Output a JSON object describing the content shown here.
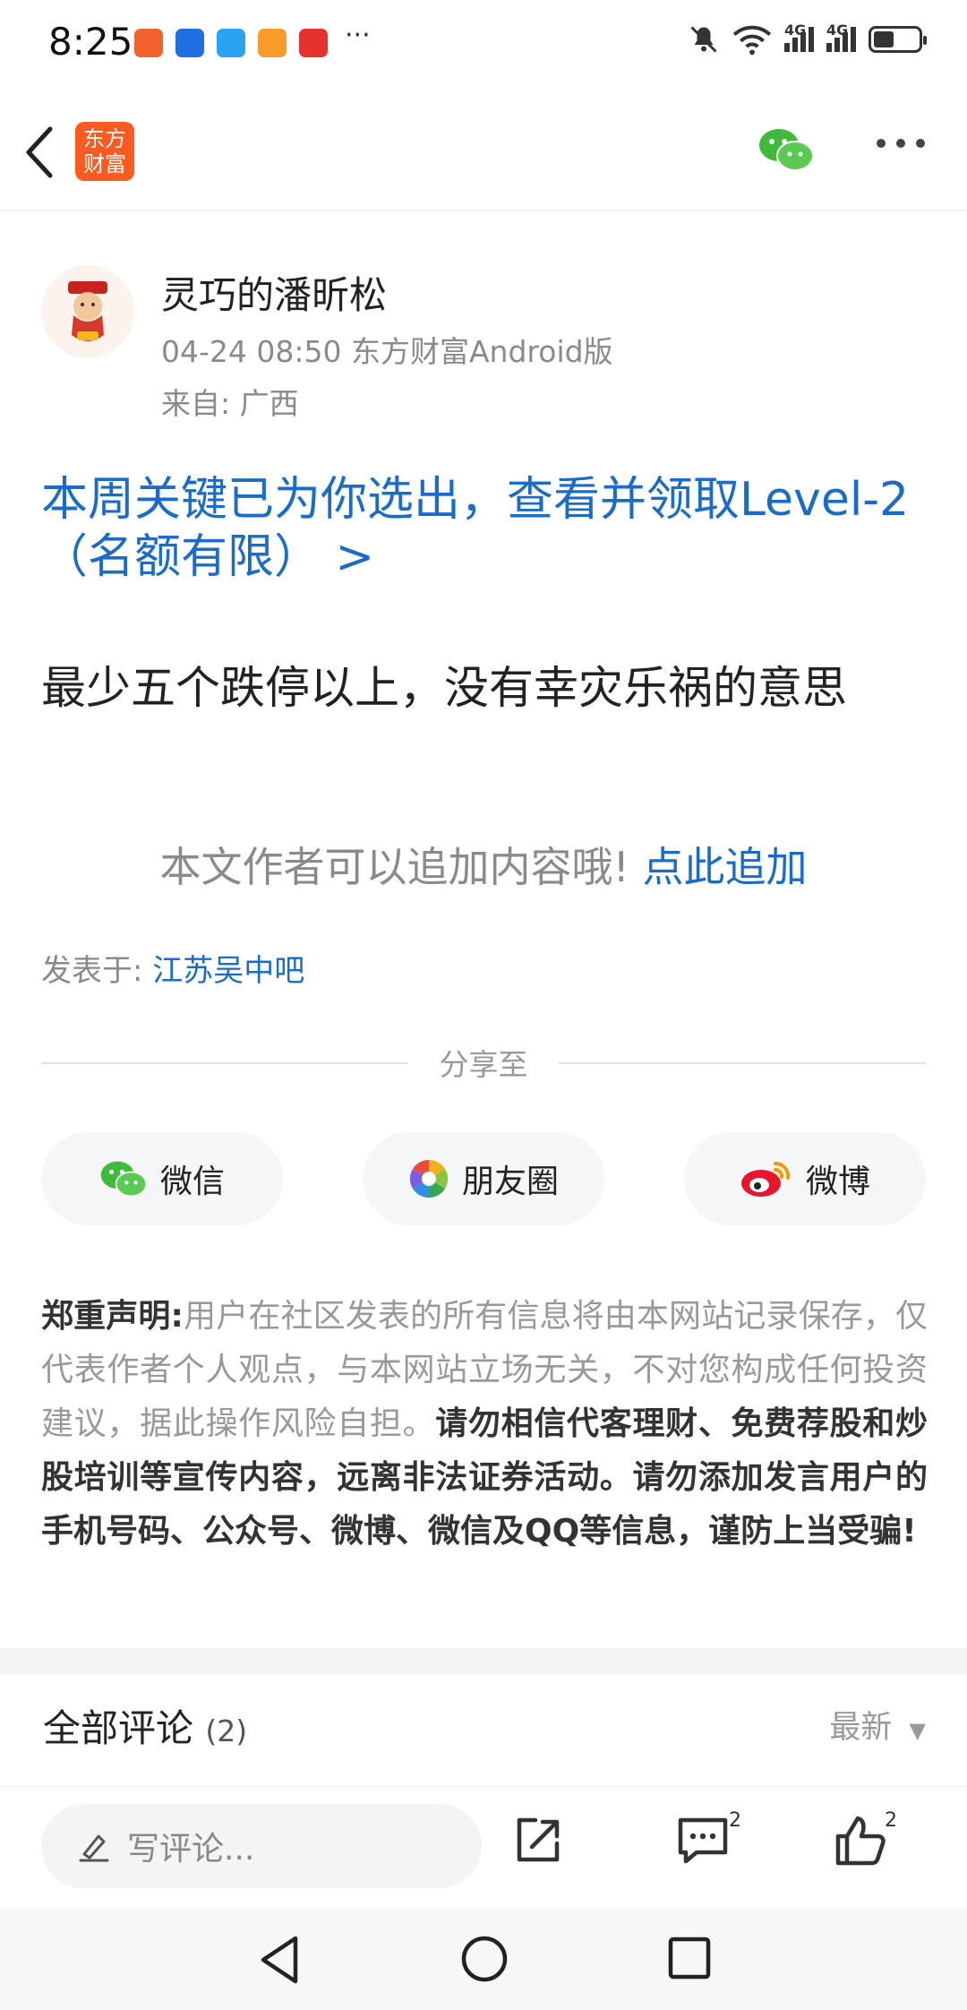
{
  "status_bar": {
    "time": "8:25",
    "more": "···",
    "network_1": "4G",
    "network_2": "4G",
    "icons": [
      "notification-app-icons",
      "mute-icon",
      "wifi-icon",
      "signal-icon",
      "battery-icon"
    ]
  },
  "app_bar": {
    "brand_line1": "东方",
    "brand_line2": "财富",
    "icons": [
      "back-icon",
      "wechat-share-icon",
      "more-icon"
    ]
  },
  "post": {
    "author": "灵巧的潘昕松",
    "meta": "04-24 08:50 东方财富Android版",
    "from": "来自: 广西",
    "promo": "本周关键已为你选出，查看并领取Level-2（名额有限） >",
    "body": "最少五个跌停以上，没有幸灾乐祸的意思",
    "append_text": "本文作者可以追加内容哦!",
    "append_link": "点此追加",
    "posted_in_label": "发表于:",
    "posted_in_bar": "江苏吴中吧"
  },
  "share": {
    "title": "分享至",
    "buttons": [
      {
        "label": "微信",
        "icon": "wechat-icon"
      },
      {
        "label": "朋友圈",
        "icon": "moments-icon"
      },
      {
        "label": "微博",
        "icon": "weibo-icon"
      }
    ]
  },
  "disclaimer": {
    "title": "郑重声明:",
    "text_gray": "用户在社区发表的所有信息将由本网站记录保存，仅代表作者个人观点，与本网站立场无关，不对您构成任何投资建议，据此操作风险自担。",
    "text_bold": "请勿相信代客理财、免费荐股和炒股培训等宣传内容，远离非法证券活动。请勿添加发言用户的手机号码、公众号、微博、微信及QQ等信息，谨防上当受骗!"
  },
  "comments": {
    "title": "全部评论",
    "count": "(2)",
    "sort": "最新"
  },
  "bottom_bar": {
    "input_placeholder": "写评论...",
    "comment_count": "2",
    "like_count": "2"
  },
  "colors": {
    "link_blue": "#1a6cc8",
    "brand_orange": "#ff5a1f",
    "wechat_green": "#3fba3c"
  }
}
